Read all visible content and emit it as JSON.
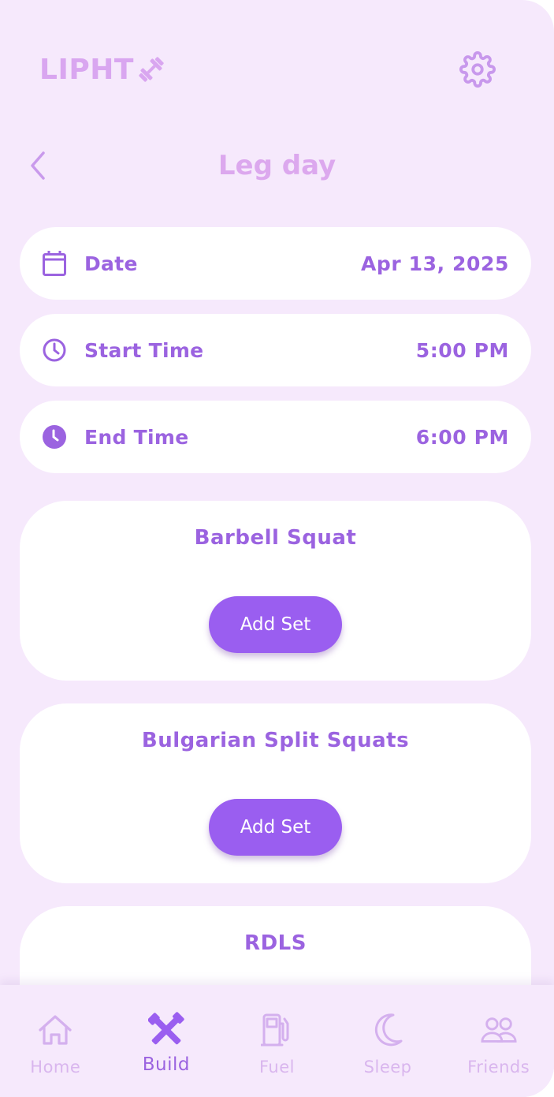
{
  "app": {
    "logo_text": "LIPHT",
    "logo_icon": "dumbbell-icon"
  },
  "header": {
    "settings_icon": "gear-icon",
    "back_icon": "chevron-left-icon",
    "title": "Leg day"
  },
  "details": [
    {
      "icon": "calendar-icon",
      "label": "Date",
      "value": "Apr 13, 2025"
    },
    {
      "icon": "clock-outline-icon",
      "label": "Start Time",
      "value": "5:00 PM"
    },
    {
      "icon": "clock-filled-icon",
      "label": "End Time",
      "value": "6:00 PM"
    }
  ],
  "exercises": [
    {
      "name": "Barbell Squat",
      "button_label": "Add Set"
    },
    {
      "name": "Bulgarian Split Squats",
      "button_label": "Add Set"
    },
    {
      "name": "RDLS"
    }
  ],
  "nav": {
    "active": "Build",
    "items": [
      {
        "label": "Home",
        "icon": "home-icon"
      },
      {
        "label": "Build",
        "icon": "tools-icon"
      },
      {
        "label": "Fuel",
        "icon": "fuel-pump-icon"
      },
      {
        "label": "Sleep",
        "icon": "moon-icon"
      },
      {
        "label": "Friends",
        "icon": "people-icon"
      }
    ]
  },
  "colors": {
    "background": "#f6e9fc",
    "accent": "#9a5ef0",
    "text_accent": "#9b63e0",
    "muted": "#d9b6ee"
  }
}
